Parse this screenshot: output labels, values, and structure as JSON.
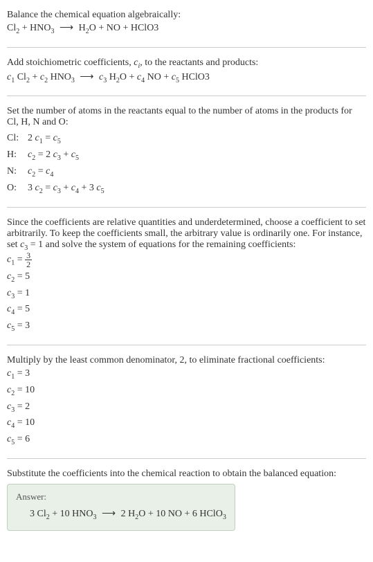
{
  "intro": {
    "line1": "Balance the chemical equation algebraically:",
    "eq_left_1": "Cl",
    "eq_left_1_sub": "2",
    "eq_plus": " + ",
    "eq_left_2": "HNO",
    "eq_left_2_sub": "3",
    "arrow": " ⟶ ",
    "eq_right_1": "H",
    "eq_right_1_sub": "2",
    "eq_right_1b": "O",
    "eq_right_2": "NO",
    "eq_right_3": "HClO3"
  },
  "stoich": {
    "text": "Add stoichiometric coefficients, ",
    "ci": "c",
    "ci_sub": "i",
    "text2": ", to the reactants and products:",
    "c1": "c",
    "c1_sub": "1",
    "cl2": " Cl",
    "cl2_sub": "2",
    "c2": "c",
    "c2_sub": "2",
    "hno3": " HNO",
    "hno3_sub": "3",
    "c3": "c",
    "c3_sub": "3",
    "h2o_h": " H",
    "h2o_sub": "2",
    "h2o_o": "O",
    "c4": "c",
    "c4_sub": "4",
    "no": " NO",
    "c5": "c",
    "c5_sub": "5",
    "hclo3": " HClO3"
  },
  "atoms": {
    "intro": "Set the number of atoms in the reactants equal to the number of atoms in the products for Cl, H, N and O:",
    "rows": [
      {
        "label": "Cl: ",
        "eq_pre": "2 ",
        "lhs_c": "c",
        "lhs_sub": "1",
        "eq": " = ",
        "rhs_c": "c",
        "rhs_sub": "5",
        "rhs_post": ""
      },
      {
        "label": "H: ",
        "eq_pre": "",
        "lhs_c": "c",
        "lhs_sub": "2",
        "eq": " = 2 ",
        "rhs_c": "c",
        "rhs_sub": "3",
        "rhs_post_pre": " + ",
        "rhs2_c": "c",
        "rhs2_sub": "5"
      },
      {
        "label": "N: ",
        "eq_pre": "",
        "lhs_c": "c",
        "lhs_sub": "2",
        "eq": " = ",
        "rhs_c": "c",
        "rhs_sub": "4",
        "rhs_post": ""
      },
      {
        "label": "O: ",
        "eq_pre": "3 ",
        "lhs_c": "c",
        "lhs_sub": "2",
        "eq": " = ",
        "rhs_c": "c",
        "rhs_sub": "3",
        "rhs_post_pre": " + ",
        "rhs2_c": "c",
        "rhs2_sub": "4",
        "rhs_post_pre2": " + 3 ",
        "rhs3_c": "c",
        "rhs3_sub": "5"
      }
    ]
  },
  "underdetermined": {
    "text_a": "Since the coefficients are relative quantities and underdetermined, choose a coefficient to set arbitrarily. To keep the coefficients small, the arbitrary value is ordinarily one. For instance, set ",
    "c3": "c",
    "c3_sub": "3",
    "text_b": " = 1 and solve the system of equations for the remaining coefficients:",
    "coeffs": [
      {
        "c": "c",
        "sub": "1",
        "eq": " = ",
        "frac_num": "3",
        "frac_den": "2"
      },
      {
        "c": "c",
        "sub": "2",
        "eq": " = 5"
      },
      {
        "c": "c",
        "sub": "3",
        "eq": " = 1"
      },
      {
        "c": "c",
        "sub": "4",
        "eq": " = 5"
      },
      {
        "c": "c",
        "sub": "5",
        "eq": " = 3"
      }
    ]
  },
  "multiply": {
    "text": "Multiply by the least common denominator, 2, to eliminate fractional coefficients:",
    "coeffs": [
      {
        "c": "c",
        "sub": "1",
        "eq": " = 3"
      },
      {
        "c": "c",
        "sub": "2",
        "eq": " = 10"
      },
      {
        "c": "c",
        "sub": "3",
        "eq": " = 2"
      },
      {
        "c": "c",
        "sub": "4",
        "eq": " = 10"
      },
      {
        "c": "c",
        "sub": "5",
        "eq": " = 6"
      }
    ]
  },
  "substitute": {
    "text": "Substitute the coefficients into the chemical reaction to obtain the balanced equation:"
  },
  "answer": {
    "label": "Answer:",
    "n1": "3 Cl",
    "n1_sub": "2",
    "plus": " + ",
    "n2": "10 HNO",
    "n2_sub": "3",
    "arrow": " ⟶ ",
    "n3": "2 H",
    "n3_sub": "2",
    "n3b": "O",
    "n4": "10 NO",
    "n5": "6 HClO",
    "n5_sub": "3"
  },
  "chart_data": {
    "type": "table",
    "title": "Balanced chemical equation coefficients",
    "unbalanced_equation": "Cl2 + HNO3 -> H2O + NO + HClO3",
    "atom_balance_equations": {
      "Cl": "2 c1 = c5",
      "H": "c2 = 2 c3 + c5",
      "N": "c2 = c4",
      "O": "3 c2 = c3 + c4 + 3 c5"
    },
    "fractional_coefficients": {
      "c1": 1.5,
      "c2": 5,
      "c3": 1,
      "c4": 5,
      "c5": 3
    },
    "integer_coefficients": {
      "c1": 3,
      "c2": 10,
      "c3": 2,
      "c4": 10,
      "c5": 6
    },
    "balanced_equation": "3 Cl2 + 10 HNO3 -> 2 H2O + 10 NO + 6 HClO3"
  }
}
